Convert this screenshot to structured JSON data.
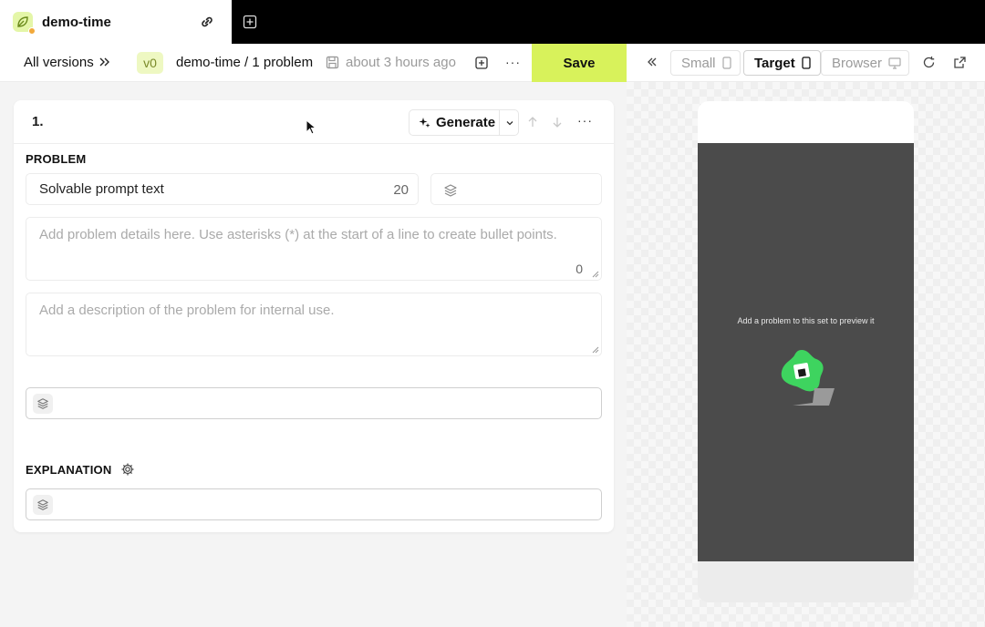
{
  "tab": {
    "title": "demo-time",
    "logo_icon": "leaf-icon",
    "link_icon": "link-icon",
    "new_tab_icon": "plus-square-icon"
  },
  "toolbar": {
    "all_versions": "All versions",
    "version_badge": "v0",
    "breadcrumb": "demo-time / 1 problem",
    "saved_time": "about 3 hours ago",
    "save_label": "Save",
    "save_color": "#d8f25b",
    "more": "···"
  },
  "preview_controls": {
    "small": "Small",
    "target": "Target",
    "browser": "Browser"
  },
  "card": {
    "number": "1.",
    "generate_label": "Generate",
    "more": "···",
    "problem_label": "PROBLEM",
    "prompt_value": "Solvable prompt text",
    "prompt_count": "20",
    "details_placeholder": "Add problem details here. Use asterisks (*) at the start of a line to create bullet points.",
    "details_count": "0",
    "description_placeholder": "Add a description of the problem for internal use.",
    "explanation_label": "EXPLANATION"
  },
  "preview": {
    "empty_message": "Add a problem to this set to preview it",
    "accent_color": "#3ed45f"
  }
}
